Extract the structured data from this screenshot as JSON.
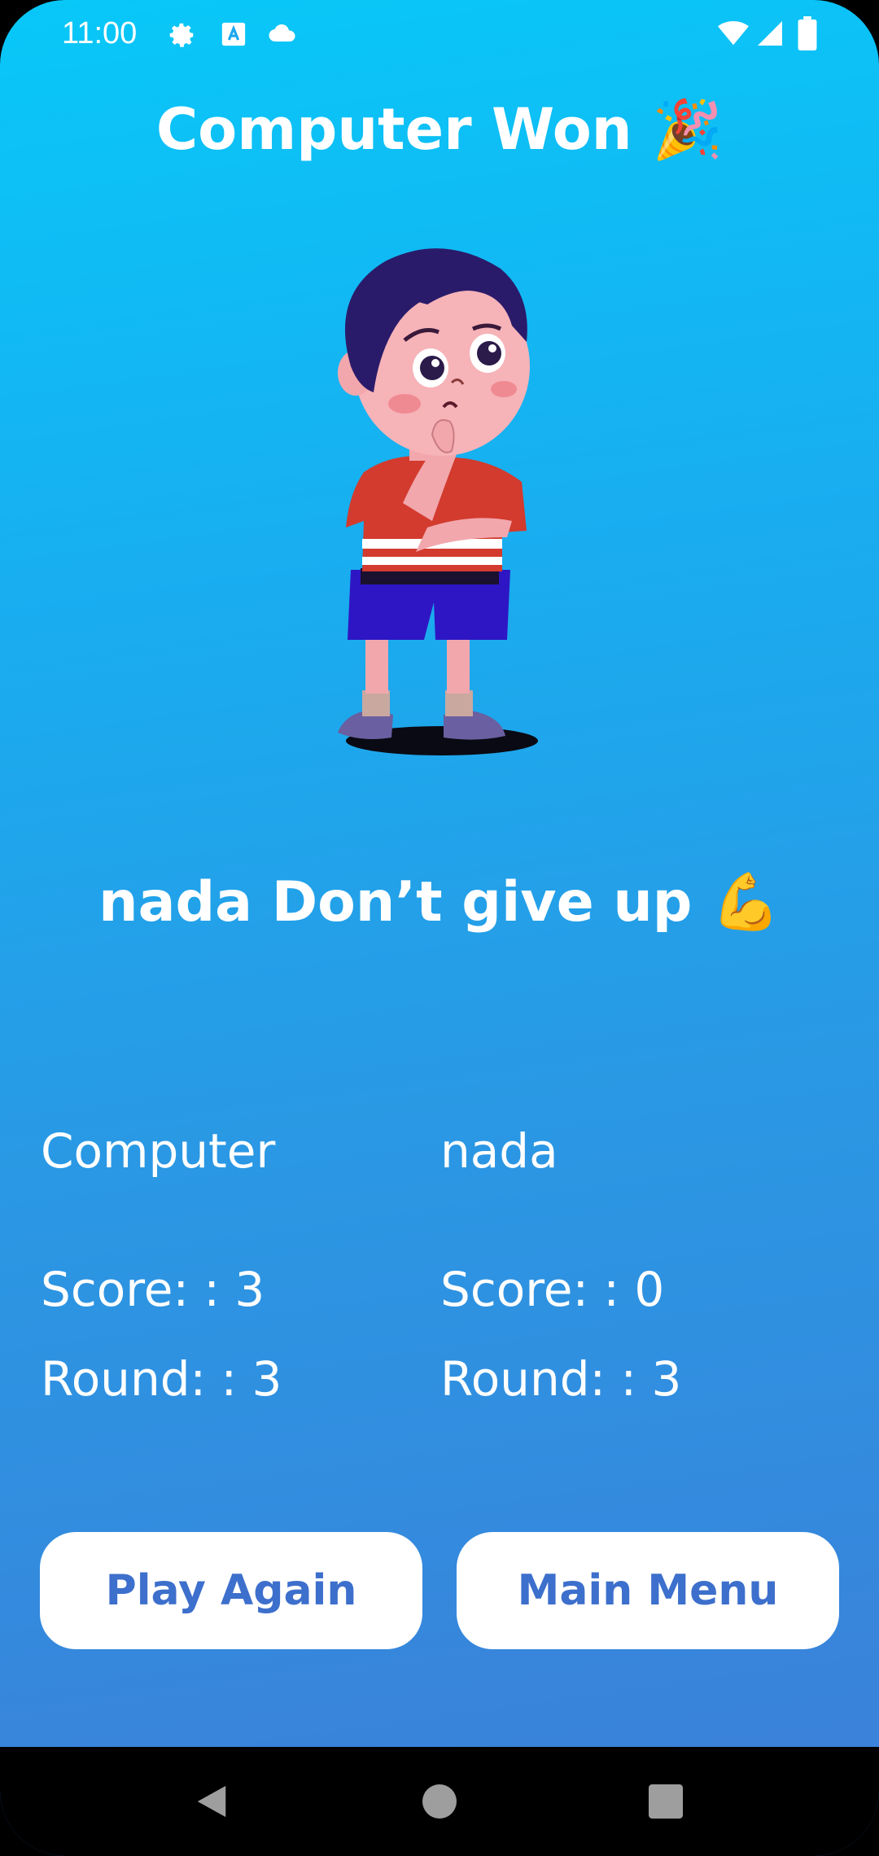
{
  "status_bar": {
    "time": "11:00",
    "left_icons": [
      "gear-icon",
      "text-a-icon",
      "cloud-icon"
    ],
    "right_icons": [
      "wifi-icon",
      "cellular-icon",
      "battery-icon"
    ]
  },
  "title": {
    "text": "Computer Won",
    "emoji": "🎉"
  },
  "illustration": {
    "description_icon": "thinking-boy-icon"
  },
  "message": {
    "text": "nada Don’t give up",
    "emoji": "💪"
  },
  "scores": {
    "computer": {
      "name": "Computer",
      "score": "Score: : 3",
      "round": "Round: : 3"
    },
    "player": {
      "name": "nada",
      "score": "Score: : 0",
      "round": "Round: : 3"
    }
  },
  "buttons": {
    "play_again": "Play Again",
    "main_menu": "Main Menu"
  },
  "nav": {
    "back": "back-icon",
    "home": "home-icon",
    "recents": "recents-icon"
  },
  "colors": {
    "gradient_top": "#08c8f8",
    "gradient_bottom": "#3d7ed8",
    "button_text": "#3d6fcc"
  }
}
